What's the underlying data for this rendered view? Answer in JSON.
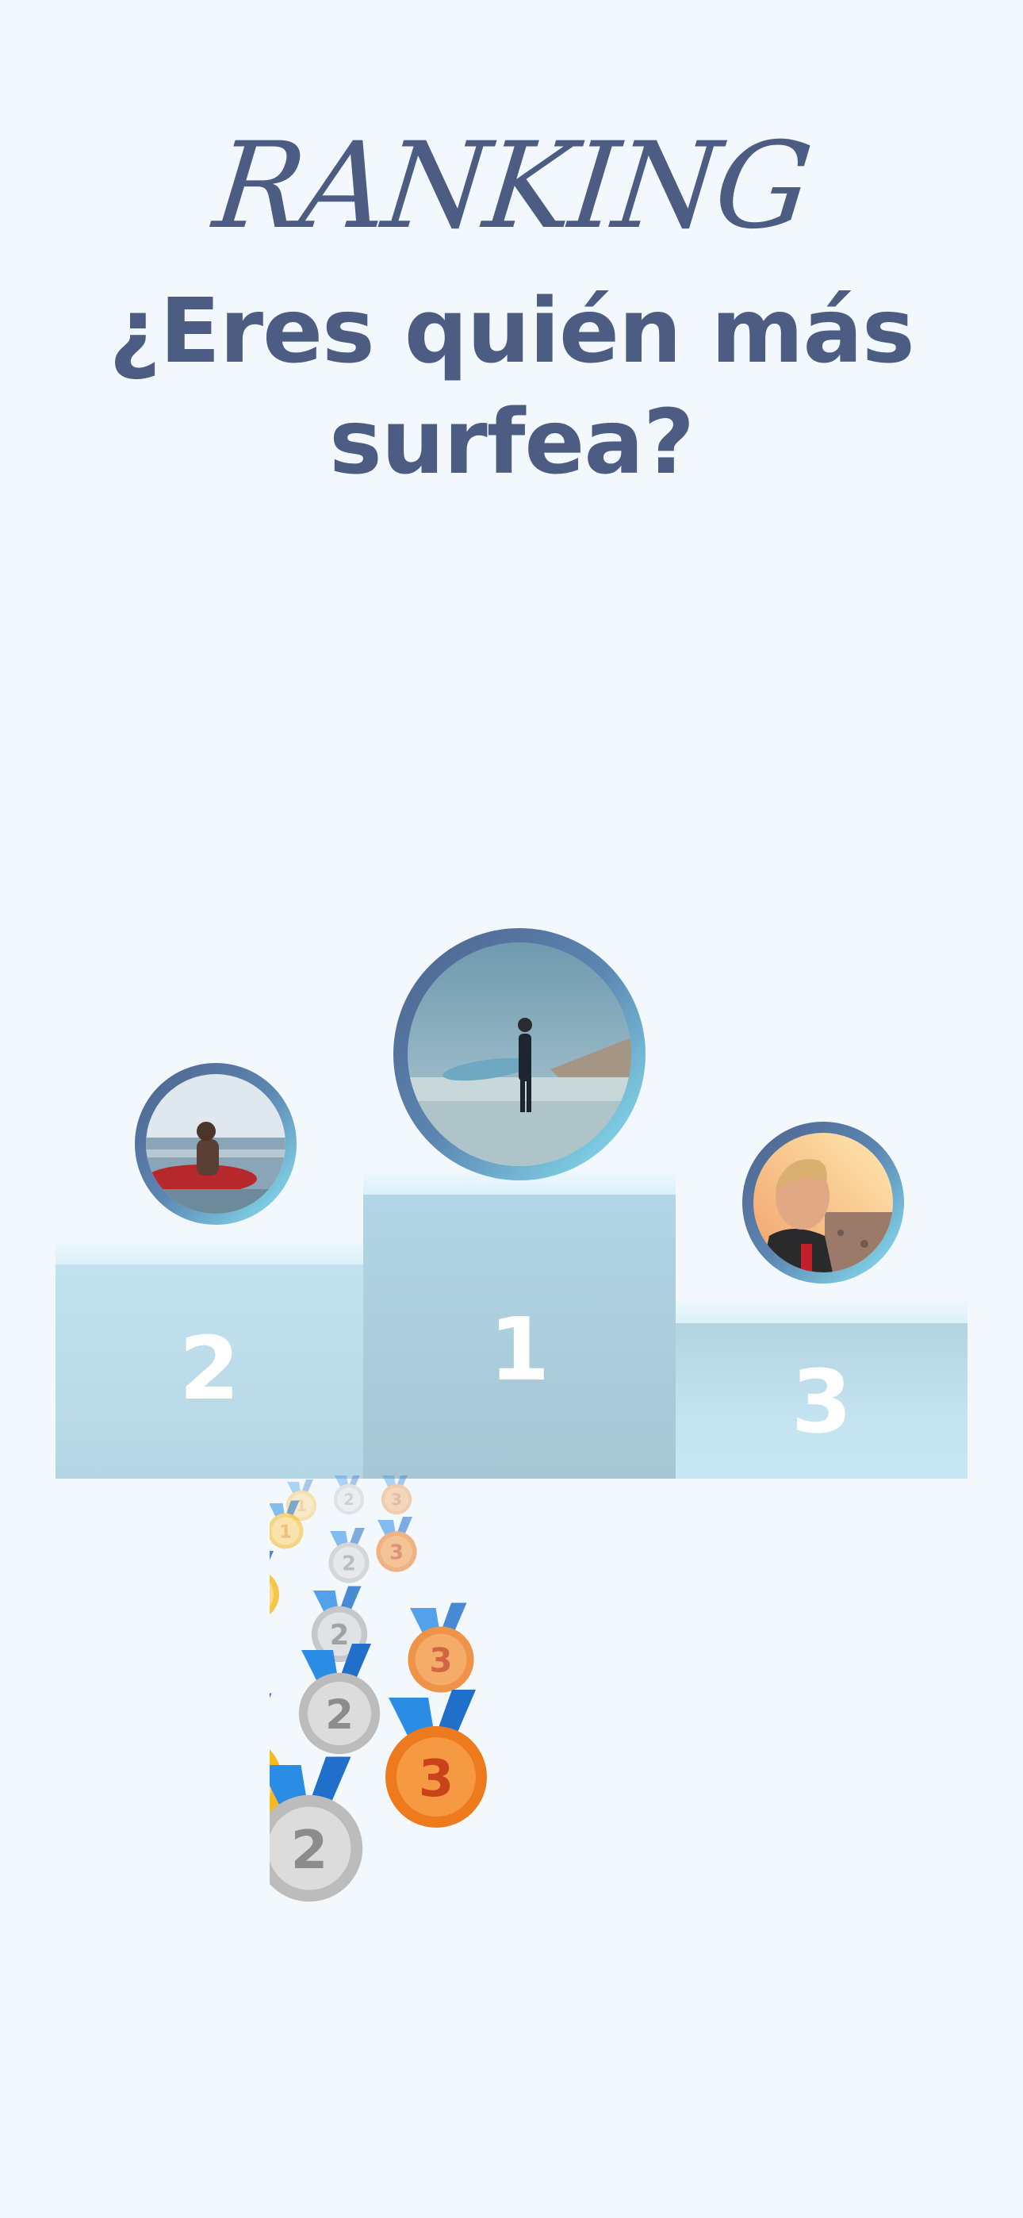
{
  "header": {
    "script_title": "RANKING",
    "headline": "¿Eres quién más surfea?"
  },
  "podium": {
    "first": "1",
    "second": "2",
    "third": "3"
  },
  "colors": {
    "background": "#f3f8fd",
    "text": "#4c5c82",
    "podium_light": "#c1e2f0",
    "podium_center": "#a9cbda",
    "ring_dark": "#4d618c",
    "ring_light": "#8be9f7",
    "gold": "#f5b622",
    "silver": "#c4c4c4",
    "bronze": "#ec7b1d",
    "ribbon": "#2b82e0"
  },
  "avatars": [
    {
      "place": "1",
      "subject": "surfer standing on beach holding board"
    },
    {
      "place": "2",
      "subject": "surfer in water with red board"
    },
    {
      "place": "3",
      "subject": "man in wetsuit at sunset"
    }
  ]
}
